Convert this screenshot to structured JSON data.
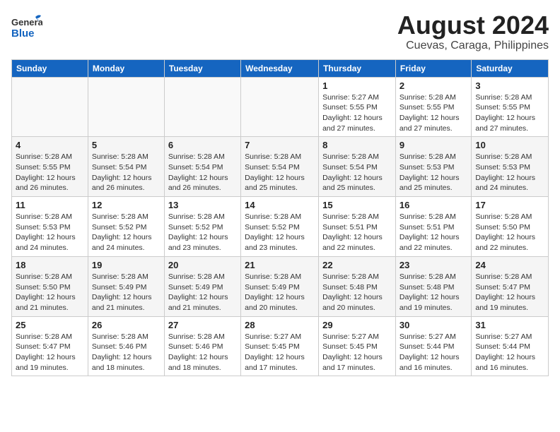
{
  "header": {
    "logo_general": "General",
    "logo_blue": "Blue",
    "title": "August 2024",
    "subtitle": "Cuevas, Caraga, Philippines"
  },
  "weekdays": [
    "Sunday",
    "Monday",
    "Tuesday",
    "Wednesday",
    "Thursday",
    "Friday",
    "Saturday"
  ],
  "weeks": [
    [
      {
        "day": "",
        "info": ""
      },
      {
        "day": "",
        "info": ""
      },
      {
        "day": "",
        "info": ""
      },
      {
        "day": "",
        "info": ""
      },
      {
        "day": "1",
        "info": "Sunrise: 5:27 AM\nSunset: 5:55 PM\nDaylight: 12 hours\nand 27 minutes."
      },
      {
        "day": "2",
        "info": "Sunrise: 5:28 AM\nSunset: 5:55 PM\nDaylight: 12 hours\nand 27 minutes."
      },
      {
        "day": "3",
        "info": "Sunrise: 5:28 AM\nSunset: 5:55 PM\nDaylight: 12 hours\nand 27 minutes."
      }
    ],
    [
      {
        "day": "4",
        "info": "Sunrise: 5:28 AM\nSunset: 5:55 PM\nDaylight: 12 hours\nand 26 minutes."
      },
      {
        "day": "5",
        "info": "Sunrise: 5:28 AM\nSunset: 5:54 PM\nDaylight: 12 hours\nand 26 minutes."
      },
      {
        "day": "6",
        "info": "Sunrise: 5:28 AM\nSunset: 5:54 PM\nDaylight: 12 hours\nand 26 minutes."
      },
      {
        "day": "7",
        "info": "Sunrise: 5:28 AM\nSunset: 5:54 PM\nDaylight: 12 hours\nand 25 minutes."
      },
      {
        "day": "8",
        "info": "Sunrise: 5:28 AM\nSunset: 5:54 PM\nDaylight: 12 hours\nand 25 minutes."
      },
      {
        "day": "9",
        "info": "Sunrise: 5:28 AM\nSunset: 5:53 PM\nDaylight: 12 hours\nand 25 minutes."
      },
      {
        "day": "10",
        "info": "Sunrise: 5:28 AM\nSunset: 5:53 PM\nDaylight: 12 hours\nand 24 minutes."
      }
    ],
    [
      {
        "day": "11",
        "info": "Sunrise: 5:28 AM\nSunset: 5:53 PM\nDaylight: 12 hours\nand 24 minutes."
      },
      {
        "day": "12",
        "info": "Sunrise: 5:28 AM\nSunset: 5:52 PM\nDaylight: 12 hours\nand 24 minutes."
      },
      {
        "day": "13",
        "info": "Sunrise: 5:28 AM\nSunset: 5:52 PM\nDaylight: 12 hours\nand 23 minutes."
      },
      {
        "day": "14",
        "info": "Sunrise: 5:28 AM\nSunset: 5:52 PM\nDaylight: 12 hours\nand 23 minutes."
      },
      {
        "day": "15",
        "info": "Sunrise: 5:28 AM\nSunset: 5:51 PM\nDaylight: 12 hours\nand 22 minutes."
      },
      {
        "day": "16",
        "info": "Sunrise: 5:28 AM\nSunset: 5:51 PM\nDaylight: 12 hours\nand 22 minutes."
      },
      {
        "day": "17",
        "info": "Sunrise: 5:28 AM\nSunset: 5:50 PM\nDaylight: 12 hours\nand 22 minutes."
      }
    ],
    [
      {
        "day": "18",
        "info": "Sunrise: 5:28 AM\nSunset: 5:50 PM\nDaylight: 12 hours\nand 21 minutes."
      },
      {
        "day": "19",
        "info": "Sunrise: 5:28 AM\nSunset: 5:49 PM\nDaylight: 12 hours\nand 21 minutes."
      },
      {
        "day": "20",
        "info": "Sunrise: 5:28 AM\nSunset: 5:49 PM\nDaylight: 12 hours\nand 21 minutes."
      },
      {
        "day": "21",
        "info": "Sunrise: 5:28 AM\nSunset: 5:49 PM\nDaylight: 12 hours\nand 20 minutes."
      },
      {
        "day": "22",
        "info": "Sunrise: 5:28 AM\nSunset: 5:48 PM\nDaylight: 12 hours\nand 20 minutes."
      },
      {
        "day": "23",
        "info": "Sunrise: 5:28 AM\nSunset: 5:48 PM\nDaylight: 12 hours\nand 19 minutes."
      },
      {
        "day": "24",
        "info": "Sunrise: 5:28 AM\nSunset: 5:47 PM\nDaylight: 12 hours\nand 19 minutes."
      }
    ],
    [
      {
        "day": "25",
        "info": "Sunrise: 5:28 AM\nSunset: 5:47 PM\nDaylight: 12 hours\nand 19 minutes."
      },
      {
        "day": "26",
        "info": "Sunrise: 5:28 AM\nSunset: 5:46 PM\nDaylight: 12 hours\nand 18 minutes."
      },
      {
        "day": "27",
        "info": "Sunrise: 5:28 AM\nSunset: 5:46 PM\nDaylight: 12 hours\nand 18 minutes."
      },
      {
        "day": "28",
        "info": "Sunrise: 5:27 AM\nSunset: 5:45 PM\nDaylight: 12 hours\nand 17 minutes."
      },
      {
        "day": "29",
        "info": "Sunrise: 5:27 AM\nSunset: 5:45 PM\nDaylight: 12 hours\nand 17 minutes."
      },
      {
        "day": "30",
        "info": "Sunrise: 5:27 AM\nSunset: 5:44 PM\nDaylight: 12 hours\nand 16 minutes."
      },
      {
        "day": "31",
        "info": "Sunrise: 5:27 AM\nSunset: 5:44 PM\nDaylight: 12 hours\nand 16 minutes."
      }
    ]
  ]
}
